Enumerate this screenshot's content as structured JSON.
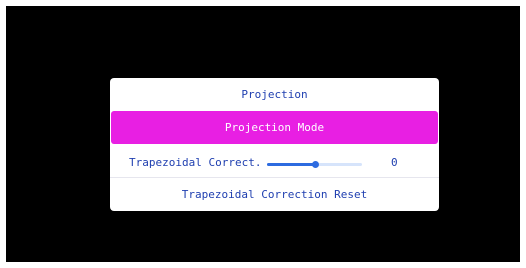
{
  "menu": {
    "title": "Projection",
    "selected_item": "Projection Mode",
    "trapezoidal": {
      "label": "Trapezoidal Correct.",
      "value": "0",
      "slider_fraction": 0.5
    },
    "reset_label": "Trapezoidal Correction Reset"
  },
  "colors": {
    "background": "#000000",
    "highlight": "#e81fe3",
    "text": "#1f3fb0",
    "slider": "#2d6be0"
  }
}
